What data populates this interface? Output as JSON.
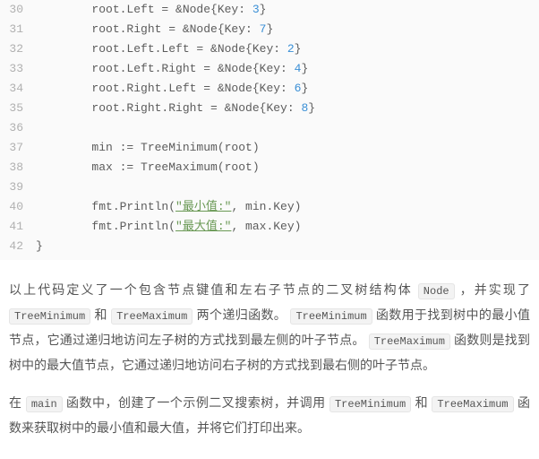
{
  "code": {
    "lines": [
      {
        "no": 30,
        "tokens": [
          {
            "cls": "tok-p",
            "t": "        root.Left = &Node{Key: "
          },
          {
            "cls": "tok-num",
            "t": "3"
          },
          {
            "cls": "tok-p",
            "t": "}"
          }
        ]
      },
      {
        "no": 31,
        "tokens": [
          {
            "cls": "tok-p",
            "t": "        root.Right = &Node{Key: "
          },
          {
            "cls": "tok-num",
            "t": "7"
          },
          {
            "cls": "tok-p",
            "t": "}"
          }
        ]
      },
      {
        "no": 32,
        "tokens": [
          {
            "cls": "tok-p",
            "t": "        root.Left.Left = &Node{Key: "
          },
          {
            "cls": "tok-num",
            "t": "2"
          },
          {
            "cls": "tok-p",
            "t": "}"
          }
        ]
      },
      {
        "no": 33,
        "tokens": [
          {
            "cls": "tok-p",
            "t": "        root.Left.Right = &Node{Key: "
          },
          {
            "cls": "tok-num",
            "t": "4"
          },
          {
            "cls": "tok-p",
            "t": "}"
          }
        ]
      },
      {
        "no": 34,
        "tokens": [
          {
            "cls": "tok-p",
            "t": "        root.Right.Left = &Node{Key: "
          },
          {
            "cls": "tok-num",
            "t": "6"
          },
          {
            "cls": "tok-p",
            "t": "}"
          }
        ]
      },
      {
        "no": 35,
        "tokens": [
          {
            "cls": "tok-p",
            "t": "        root.Right.Right = &Node{Key: "
          },
          {
            "cls": "tok-num",
            "t": "8"
          },
          {
            "cls": "tok-p",
            "t": "}"
          }
        ]
      },
      {
        "no": 36,
        "tokens": [
          {
            "cls": "tok-p",
            "t": ""
          }
        ]
      },
      {
        "no": 37,
        "tokens": [
          {
            "cls": "tok-p",
            "t": "        min := TreeMinimum(root)"
          }
        ]
      },
      {
        "no": 38,
        "tokens": [
          {
            "cls": "tok-p",
            "t": "        max := TreeMaximum(root)"
          }
        ]
      },
      {
        "no": 39,
        "tokens": [
          {
            "cls": "tok-p",
            "t": ""
          }
        ]
      },
      {
        "no": 40,
        "tokens": [
          {
            "cls": "tok-p",
            "t": "        fmt.Println("
          },
          {
            "cls": "tok-str",
            "t": "\"最小值:\""
          },
          {
            "cls": "tok-p",
            "t": ", min.Key)"
          }
        ]
      },
      {
        "no": 41,
        "tokens": [
          {
            "cls": "tok-p",
            "t": "        fmt.Println("
          },
          {
            "cls": "tok-str",
            "t": "\"最大值:\""
          },
          {
            "cls": "tok-p",
            "t": ", max.Key)"
          }
        ]
      },
      {
        "no": 42,
        "tokens": [
          {
            "cls": "tok-p",
            "t": "}"
          }
        ]
      }
    ]
  },
  "prose": {
    "p1": {
      "s1": "以上代码定义了一个包含节点键值和左右子节点的二叉树结构体 ",
      "c1": "Node",
      "s2": " ，并实现了 ",
      "c2": "TreeMinimum",
      "s3": " 和 ",
      "c3": "TreeMaximum",
      "s4": " 两个递归函数。 ",
      "c4": "TreeMinimum",
      "s5": " 函数用于找到树中的最小值节点，它通过递归地访问左子树的方式找到最左侧的叶子节点。 ",
      "c5": "TreeMaximum",
      "s6": " 函数则是找到树中的最大值节点，它通过递归地访问右子树的方式找到最右侧的叶子节点。"
    },
    "p2": {
      "s1": "在 ",
      "c1": "main",
      "s2": " 函数中，创建了一个示例二叉搜索树，并调用 ",
      "c2": "TreeMinimum",
      "s3": " 和 ",
      "c3": "TreeMaximum",
      "s4": " 函数来获取树中的最小值和最大值，并将它们打印出来。"
    }
  }
}
